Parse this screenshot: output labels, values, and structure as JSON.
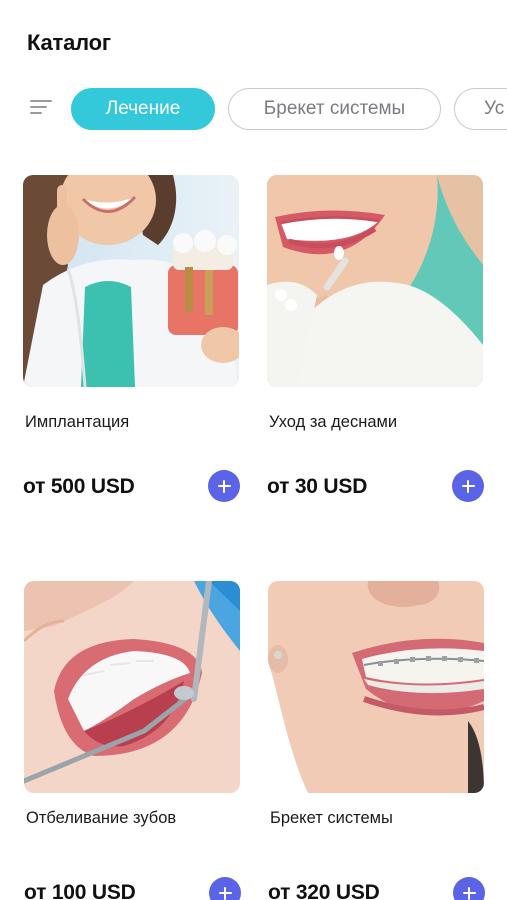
{
  "header": {
    "title": "Каталог"
  },
  "filter": {
    "menu_icon": "filter-lines-icon"
  },
  "chips": [
    {
      "label": "Лечение",
      "active": true
    },
    {
      "label": "Брекет системы",
      "active": false
    },
    {
      "label": "Ус",
      "active": false
    }
  ],
  "colors": {
    "accent": "#34c9da",
    "add_button": "#5b64e6",
    "chip_border": "#c9c9cf"
  },
  "products": [
    {
      "name": "Имплантация",
      "price": "от 500 USD",
      "image": "dental-implant-photo",
      "add_icon": "plus-icon"
    },
    {
      "name": "Уход за деснами",
      "price": "от 30 USD",
      "image": "veneer-smile-photo",
      "add_icon": "plus-icon"
    },
    {
      "name": "Отбеливание зубов",
      "price": "от 100 USD",
      "image": "teeth-whitening-photo",
      "add_icon": "plus-icon"
    },
    {
      "name": "Брекет системы",
      "price": "от 320 USD",
      "image": "braces-smile-photo",
      "add_icon": "plus-icon"
    }
  ]
}
